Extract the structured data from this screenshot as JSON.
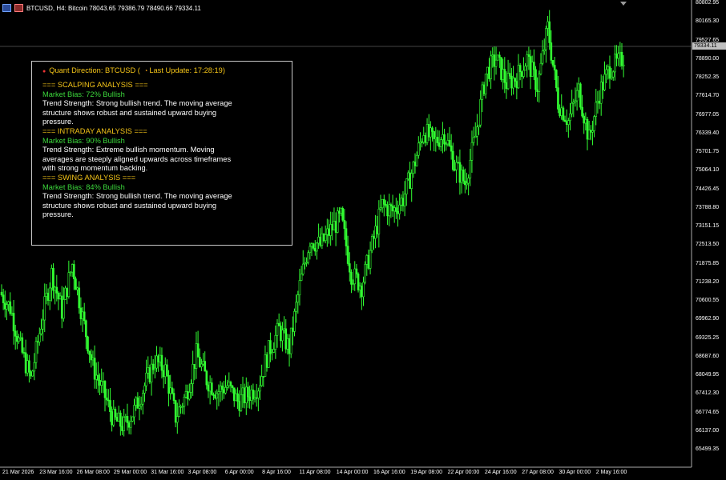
{
  "header": {
    "text": "BTCUSD, H4:  Bitcoin  78043.65 79386.79 78490.66 79334.11"
  },
  "panel": {
    "title_text": "Quant Direction: BTCUSD (",
    "title_time": "Last Update: 17:28:19)",
    "lines": [
      {
        "text": "=== SCALPING ANALYSIS ===",
        "color": "yellow"
      },
      {
        "text": "Market Bias: 72% Bullish",
        "color": "green"
      },
      {
        "text": "Trend Strength: Strong bullish trend. The moving average structure shows robust and sustained upward buying pressure.",
        "color": "white"
      },
      {
        "text": "=== INTRADAY ANALYSIS ===",
        "color": "yellow"
      },
      {
        "text": "Market Bias: 90% Bullish",
        "color": "green"
      },
      {
        "text": "Trend Strength: Extreme bullish momentum. Moving averages are steeply aligned upwards across timeframes with strong momentum backing.",
        "color": "white"
      },
      {
        "text": "=== SWING ANALYSIS ===",
        "color": "yellow"
      },
      {
        "text": "Market Bias: 84% Bullish",
        "color": "green"
      },
      {
        "text": "Trend Strength: Strong bullish trend. The moving average structure shows robust and sustained upward buying pressure.",
        "color": "white"
      }
    ]
  },
  "price_label": "79334.11",
  "chart_data": {
    "type": "candlestick",
    "symbol": "BTCUSD",
    "timeframe": "H4",
    "ylim": [
      65180,
      80180
    ],
    "y_ticks": [
      "80802.95",
      "80165.30",
      "79527.65",
      "78890.00",
      "78252.35",
      "77614.70",
      "76977.05",
      "76339.40",
      "75701.75",
      "75064.10",
      "74426.45",
      "73788.80",
      "73151.15",
      "72513.50",
      "71875.85",
      "71238.20",
      "70600.55",
      "69962.90",
      "69325.25",
      "68687.60",
      "68049.95",
      "67412.30",
      "66774.65",
      "66137.00",
      "65499.35"
    ],
    "x_ticks": [
      "21 Mar 2026",
      "23 Mar 16:00",
      "26 Mar 08:00",
      "29 Mar 00:00",
      "31 Mar 16:00",
      "3 Apr 08:00",
      "6 Apr 00:00",
      "8 Apr 16:00",
      "11 Apr 08:00",
      "14 Apr 00:00",
      "16 Apr 16:00",
      "19 Apr 08:00",
      "22 Apr 00:00",
      "24 Apr 16:00",
      "27 Apr 08:00",
      "30 Apr 00:00",
      "2 May 16:00"
    ],
    "path_close": [
      70800,
      70300,
      69000,
      68000,
      69800,
      71400,
      70200,
      71700,
      70000,
      68400,
      67600,
      66700,
      66500,
      67000,
      67800,
      68600,
      68300,
      66800,
      67500,
      68800,
      68000,
      67600,
      67800,
      67300,
      67500,
      67800,
      68900,
      69600,
      69000,
      71000,
      72500,
      72300,
      72800,
      73200,
      71400,
      71000,
      72300,
      73600,
      73400,
      73800,
      74800,
      76000,
      75600,
      75900,
      74900,
      74300,
      75800,
      77800,
      78300,
      77500,
      77700,
      78300,
      77400,
      79300,
      76900,
      76300,
      77300,
      75700,
      77200,
      78000,
      78200,
      78700,
      79334
    ]
  },
  "colors": {
    "background": "#000000",
    "candle": "#32ff32",
    "panel_title": "#f5c518",
    "bias": "#3cd83c",
    "axis": "#ffffff"
  }
}
